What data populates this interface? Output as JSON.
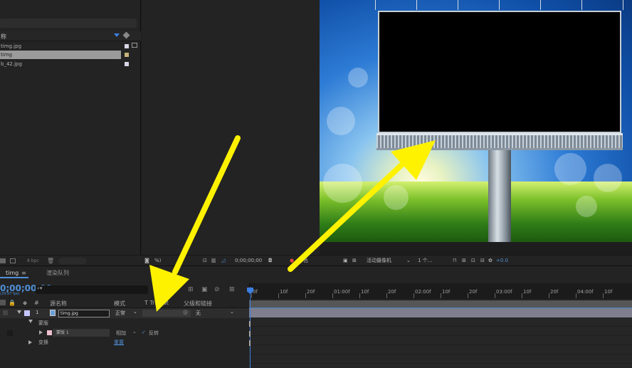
{
  "project": {
    "name_header": "称",
    "files": [
      {
        "name": "timg.jpg",
        "selected": false
      },
      {
        "name": "timg",
        "selected": true
      },
      {
        "name": "b_42.jpg",
        "selected": false
      }
    ],
    "bpc": "8 bpc"
  },
  "viewer_toolbar": {
    "zoom": "%)",
    "timecode": "0;00;00;00",
    "channel": "彩色",
    "camera": "活动摄像机",
    "views": "1 个...",
    "exposure": "+0.0"
  },
  "timeline": {
    "tab_comp": "timg",
    "tab_render": "渲染队列",
    "timecode": "0;00;00;00",
    "timecode_sub": "(29.97 fps)",
    "columns": {
      "num": "#",
      "source_name": "源名称",
      "mode": "模式",
      "trkmat": "T TrkMat",
      "parent": "父级和链接"
    },
    "layer": {
      "index": "1",
      "name": "timg.jpg",
      "mode": "正常",
      "parent": "无"
    },
    "masks_group": "蒙版",
    "mask": {
      "name": "蒙版 1",
      "mode": "相加",
      "inverted_label": "反转"
    },
    "transform": "变换",
    "reset": "重置",
    "ruler_ticks": [
      "0f",
      "10f",
      "20f",
      "01:00f",
      "10f",
      "20f",
      "02:00f",
      "10f",
      "20f",
      "03:00f",
      "10f",
      "20f",
      "04:00f",
      "10f"
    ]
  },
  "colors": {
    "accent": "#4f8fd6",
    "arrow": "#fff200"
  }
}
